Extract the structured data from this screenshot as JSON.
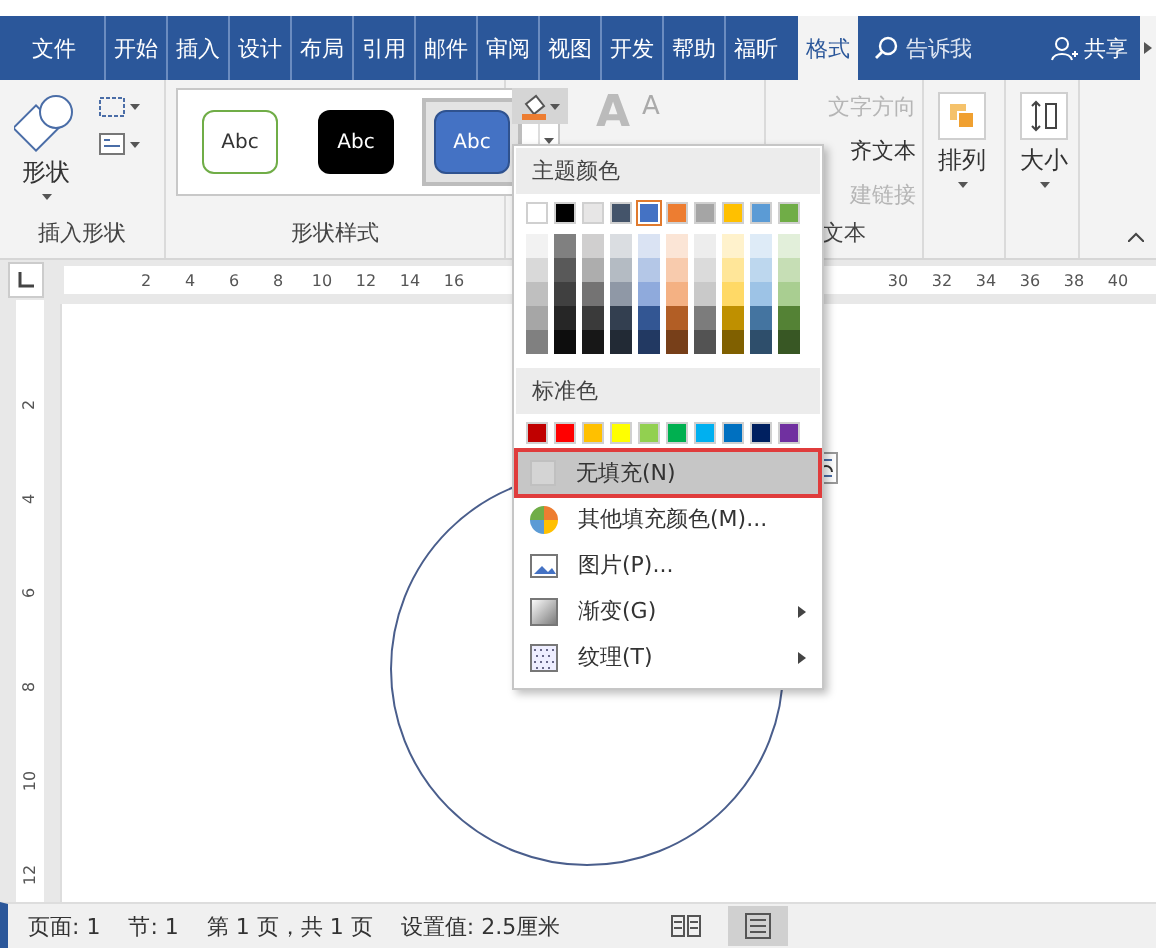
{
  "tabs": [
    {
      "label": "文件",
      "selected": false
    },
    {
      "label": "开始",
      "selected": false
    },
    {
      "label": "插入",
      "selected": false
    },
    {
      "label": "设计",
      "selected": false
    },
    {
      "label": "布局",
      "selected": false
    },
    {
      "label": "引用",
      "selected": false
    },
    {
      "label": "邮件",
      "selected": false
    },
    {
      "label": "审阅",
      "selected": false
    },
    {
      "label": "视图",
      "selected": false
    },
    {
      "label": "开发",
      "selected": false
    },
    {
      "label": "帮助",
      "selected": false
    },
    {
      "label": "福昕",
      "selected": false
    },
    {
      "label": "格式",
      "selected": true
    }
  ],
  "tell_me": "告诉我",
  "share": "共享",
  "ribbon": {
    "insert_shapes": {
      "shape_label": "形状",
      "group_label": "插入形状"
    },
    "shape_styles": {
      "swatches": [
        {
          "label": "Abc",
          "kind": "outline",
          "selected": false
        },
        {
          "label": "Abc",
          "kind": "black",
          "selected": false
        },
        {
          "label": "Abc",
          "kind": "blue",
          "selected": true
        }
      ],
      "group_label": "形状样式"
    },
    "wordart": {
      "large_letter": "A",
      "small_letter": "A"
    },
    "text": {
      "items": [
        {
          "label": "文字方向",
          "disabled": true
        },
        {
          "label": "齐文本",
          "disabled": false
        },
        {
          "label": "建链接",
          "disabled": true
        }
      ],
      "group_label": "文本"
    },
    "arrange": "排列",
    "size": "大小"
  },
  "ruler": {
    "left_numbers": [
      "2",
      "4",
      "6",
      "8",
      "10",
      "12",
      "14",
      "16"
    ],
    "right_numbers": [
      "30",
      "32",
      "34",
      "36",
      "38",
      "40"
    ],
    "vertical_numbers": [
      "2",
      "4",
      "6",
      "8",
      "10",
      "12"
    ]
  },
  "fill_menu": {
    "theme_header": "主题颜色",
    "theme_colors": [
      {
        "color": "#ffffff",
        "selected": false
      },
      {
        "color": "#000000",
        "selected": false
      },
      {
        "color": "#e7e6e6",
        "selected": false
      },
      {
        "color": "#44546a",
        "selected": false
      },
      {
        "color": "#4472c4",
        "selected": true
      },
      {
        "color": "#ed7d31",
        "selected": false
      },
      {
        "color": "#a5a5a5",
        "selected": false
      },
      {
        "color": "#ffc000",
        "selected": false
      },
      {
        "color": "#5b9bd5",
        "selected": false
      },
      {
        "color": "#70ad47",
        "selected": false
      }
    ],
    "standard_header": "标准色",
    "standard_colors": [
      {
        "color": "#c00000",
        "selected": false
      },
      {
        "color": "#ff0000",
        "selected": false
      },
      {
        "color": "#ffc000",
        "selected": false
      },
      {
        "color": "#ffff00",
        "selected": false
      },
      {
        "color": "#92d050",
        "selected": false
      },
      {
        "color": "#00b050",
        "selected": false
      },
      {
        "color": "#00b0f0",
        "selected": false
      },
      {
        "color": "#0070c0",
        "selected": false
      },
      {
        "color": "#002060",
        "selected": false
      },
      {
        "color": "#7030a0",
        "selected": false
      }
    ],
    "items": [
      {
        "kind": "no-fill",
        "label": "无填充(N)",
        "selected": true,
        "submenu": false
      },
      {
        "kind": "more-colors",
        "label": "其他填充颜色(M)...",
        "selected": false,
        "submenu": false
      },
      {
        "kind": "picture",
        "label": "图片(P)...",
        "selected": false,
        "submenu": false
      },
      {
        "kind": "gradient",
        "label": "渐变(G)",
        "selected": false,
        "submenu": true
      },
      {
        "kind": "texture",
        "label": "纹理(T)",
        "selected": false,
        "submenu": true
      }
    ]
  },
  "status_bar": {
    "items": [
      "页面: 1",
      "节: 1",
      "第 1 页，共 1 页",
      "设置值: 2.5厘米"
    ],
    "views": [
      {
        "kind": "read",
        "selected": false
      },
      {
        "kind": "print",
        "selected": true
      }
    ]
  }
}
